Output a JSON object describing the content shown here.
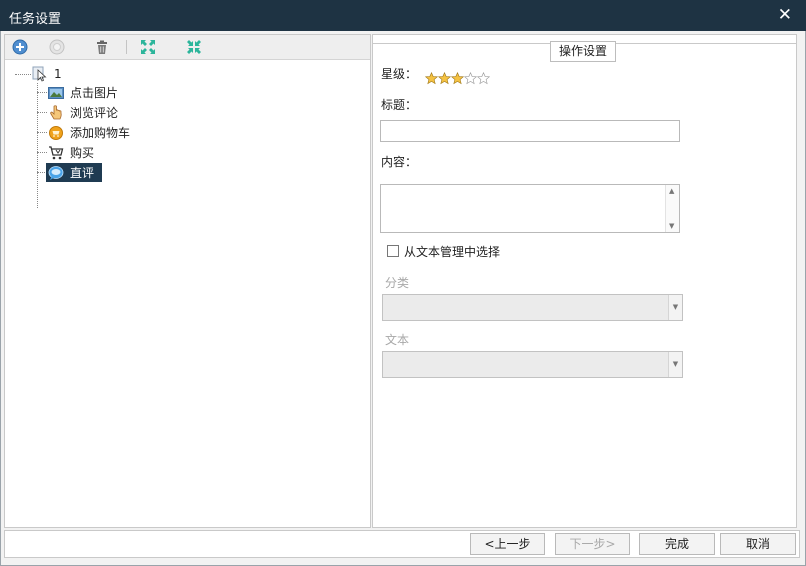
{
  "window": {
    "title": "任务设置",
    "close_glyph": "✕"
  },
  "toolbar": {
    "buttons": [
      {
        "icon": "add-circle-icon",
        "enabled": true
      },
      {
        "icon": "disabled-circle-icon",
        "enabled": false
      },
      {
        "icon": "trash-icon",
        "enabled": true
      },
      {
        "icon": "expand-icon",
        "enabled": true
      },
      {
        "icon": "collapse-icon",
        "enabled": true
      }
    ]
  },
  "tree": {
    "root": {
      "label": "1",
      "icon": "cursor-icon",
      "expander": "-"
    },
    "items": [
      {
        "label": "点击图片",
        "icon": "image-icon"
      },
      {
        "label": "浏览评论",
        "icon": "hand-pointer-icon"
      },
      {
        "label": "添加购物车",
        "icon": "cart-badge-icon"
      },
      {
        "label": "购买",
        "icon": "shopping-cart-icon"
      },
      {
        "label": "直评",
        "icon": "chat-bubble-icon",
        "selected": true
      }
    ]
  },
  "settings": {
    "group_title": "操作设置",
    "rating_label": "星级：",
    "rating": {
      "filled": 3,
      "max": 5
    },
    "title_label": "标题：",
    "title_value": "",
    "content_label": "内容：",
    "content_value": "",
    "checkbox_label": "从文本管理中选择",
    "checkbox_checked": false,
    "category_label": "分类",
    "category_value": "",
    "text_label": "文本",
    "text_value": ""
  },
  "buttons": {
    "prev": "<上一步",
    "next": "下一步>",
    "finish": "完成",
    "cancel": "取消"
  },
  "colors": {
    "titlebar": "#1e3343",
    "selection": "#1f3b52",
    "star_fill": "#f5c242",
    "expand_icon": "#2cb59b"
  }
}
